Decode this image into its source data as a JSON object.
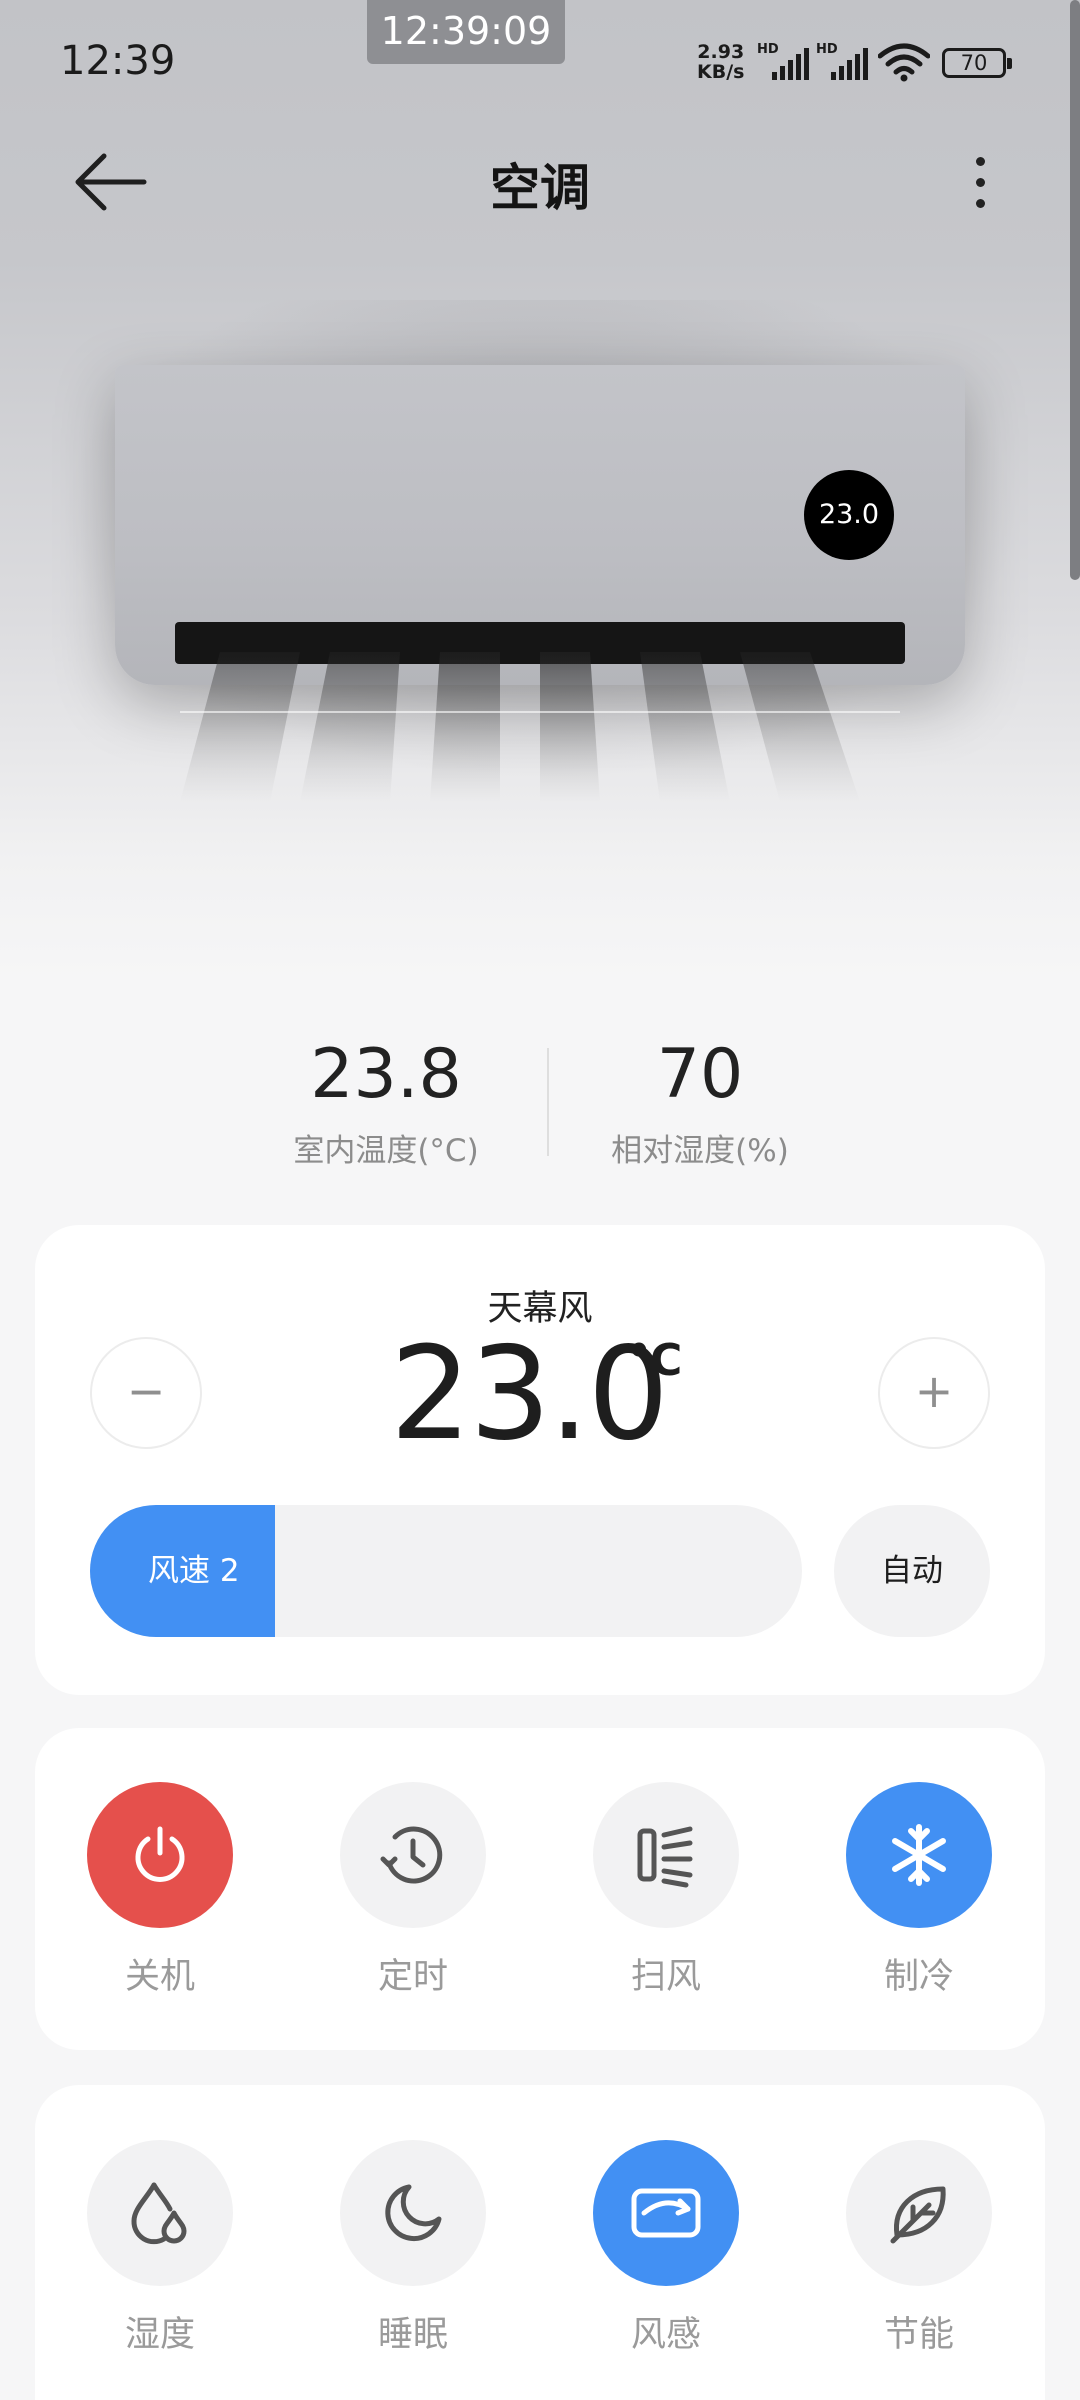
{
  "status_bar": {
    "time": "12:39",
    "floating_clock": "12:39:09",
    "net_speed_value": "2.93",
    "net_speed_unit": "KB/s",
    "sim1_label": "HD",
    "sim2_label": "HD",
    "battery": "70"
  },
  "header": {
    "title": "空调",
    "back_icon": "arrow-left-icon",
    "more_icon": "more-vertical-icon"
  },
  "device_display": {
    "set_temp": "23.0"
  },
  "readings": {
    "indoor_temp": {
      "value": "23.8",
      "label": "室内温度(°C)"
    },
    "humidity": {
      "value": "70",
      "label": "相对湿度(%)"
    }
  },
  "thermostat": {
    "mode_label": "天幕风",
    "temperature": "23.0",
    "unit": "°C",
    "decrease_label": "−",
    "increase_label": "+",
    "fan_label": "风速 2",
    "fan_level_fraction": 0.26,
    "auto_label": "自动"
  },
  "controls": [
    {
      "label": "关机",
      "icon": "power-icon",
      "active": true,
      "color": "#e5504c"
    },
    {
      "label": "定时",
      "icon": "clock-icon",
      "active": false
    },
    {
      "label": "扫风",
      "icon": "swing-icon",
      "active": false
    },
    {
      "label": "制冷",
      "icon": "snowflake-icon",
      "active": true,
      "color": "#4290f3"
    }
  ],
  "features": [
    {
      "label": "湿度",
      "icon": "humidity-drop-icon",
      "active": false
    },
    {
      "label": "睡眠",
      "icon": "moon-icon",
      "active": false
    },
    {
      "label": "风感",
      "icon": "wind-sense-icon",
      "active": true,
      "color": "#4290f3"
    },
    {
      "label": "节能",
      "icon": "leaf-icon",
      "active": false
    }
  ],
  "colors": {
    "accent_blue": "#4290f3",
    "power_red": "#e5504c",
    "background": "#f6f6f7"
  }
}
